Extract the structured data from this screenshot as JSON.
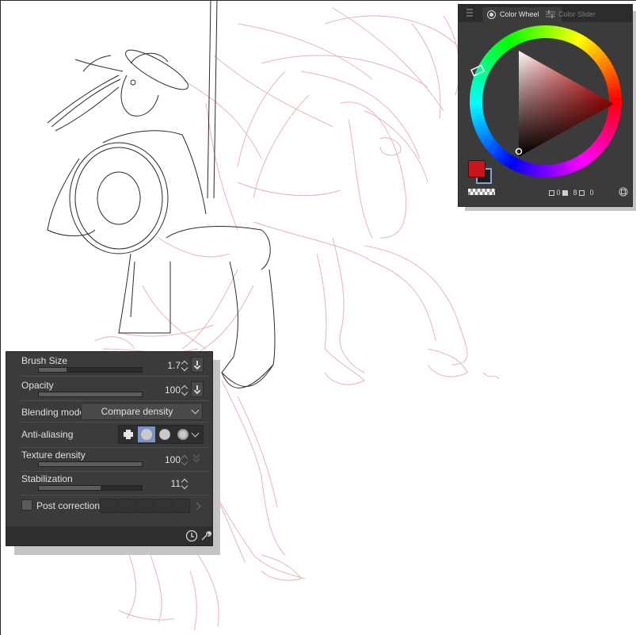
{
  "color_wheel_panel": {
    "tabs": [
      {
        "label": "Color Wheel",
        "active": true
      },
      {
        "label": "Color Slider",
        "active": false
      }
    ],
    "main_color": "#c8141a",
    "sub_color": "#1e1e1e",
    "readouts": [
      "0",
      "8",
      "0"
    ],
    "icons": [
      "menu-grip-icon",
      "color-wheel-icon",
      "color-slider-icon",
      "hsv-square-icon",
      "fullscreen-icon"
    ]
  },
  "tool_property": {
    "brush_size": {
      "label": "Brush Size",
      "value": "1.7",
      "fill": 0.27
    },
    "opacity": {
      "label": "Opacity",
      "value": "100",
      "fill": 1.0
    },
    "blending_mode": {
      "label": "Blending mode",
      "value": "Compare density"
    },
    "anti_aliasing": {
      "label": "Anti-aliasing",
      "selected_index": 1
    },
    "texture_density": {
      "label": "Texture density",
      "value": "100",
      "fill": 1.0
    },
    "stabilization": {
      "label": "Stabilization",
      "value": "11",
      "fill": 0.6
    },
    "post_correction": {
      "label": "Post correction",
      "checked": false
    },
    "footer_icons": [
      "clock-reset-icon",
      "wrench-icon"
    ]
  },
  "accent_colors": {
    "panel_bg": "#3b3b3b",
    "selected": "#7f92c8",
    "sketch_line": "#e8b4b4",
    "ink_line": "#2a2a2a"
  }
}
